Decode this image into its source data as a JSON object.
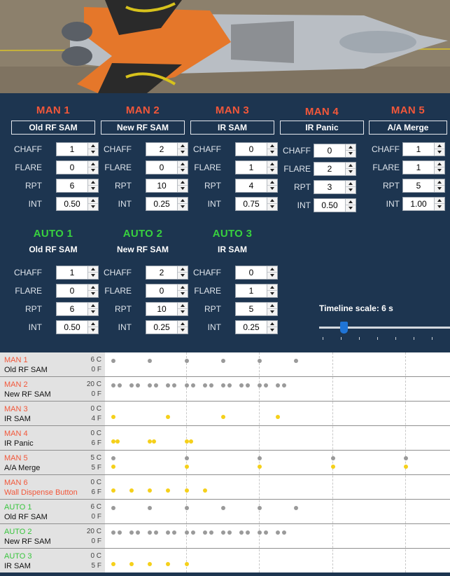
{
  "colors": {
    "man": "#f2573a",
    "auto": "#38d13f",
    "panel": "#1d3550",
    "chaff_dot": "#9a9a9a",
    "flare_dot": "#f5d01a",
    "slider": "#1f74d6"
  },
  "field_labels": {
    "chaff": "CHAFF",
    "flare": "FLARE",
    "rpt": "RPT",
    "int": "INT"
  },
  "manual_programs": [
    {
      "title": "MAN 1",
      "name": "Old RF SAM",
      "chaff": "1",
      "flare": "0",
      "rpt": "6",
      "int": "0.50"
    },
    {
      "title": "MAN 2",
      "name": "New RF SAM",
      "chaff": "2",
      "flare": "0",
      "rpt": "10",
      "int": "0.25"
    },
    {
      "title": "MAN 3",
      "name": "IR SAM",
      "chaff": "0",
      "flare": "1",
      "rpt": "4",
      "int": "0.75"
    },
    {
      "title": "MAN 4",
      "name": "IR Panic",
      "chaff": "0",
      "flare": "2",
      "rpt": "3",
      "int": "0.50"
    },
    {
      "title": "MAN 5",
      "name": "A/A Merge",
      "chaff": "1",
      "flare": "1",
      "rpt": "5",
      "int": "1.00"
    }
  ],
  "auto_programs": [
    {
      "title": "AUTO 1",
      "name": "Old RF SAM",
      "chaff": "1",
      "flare": "0",
      "rpt": "6",
      "int": "0.50"
    },
    {
      "title": "AUTO 2",
      "name": "New RF SAM",
      "chaff": "2",
      "flare": "0",
      "rpt": "10",
      "int": "0.25"
    },
    {
      "title": "AUTO 3",
      "name": "IR SAM",
      "chaff": "0",
      "flare": "1",
      "rpt": "5",
      "int": "0.25"
    }
  ],
  "timeline_scale": {
    "label": "Timeline scale: 6 s",
    "seconds": 6
  },
  "timeline": [
    {
      "name": "MAN 1",
      "kind": "man",
      "desc": "Old RF SAM",
      "c": "6 C",
      "f": "0 F",
      "chaff_per": 1,
      "flare_per": 0,
      "rpt": 6,
      "int": 0.5
    },
    {
      "name": "MAN 2",
      "kind": "man",
      "desc": "New RF SAM",
      "c": "20 C",
      "f": "0 F",
      "chaff_per": 2,
      "flare_per": 0,
      "rpt": 10,
      "int": 0.25
    },
    {
      "name": "MAN 3",
      "kind": "man",
      "desc": "IR SAM",
      "c": "0 C",
      "f": "4 F",
      "chaff_per": 0,
      "flare_per": 1,
      "rpt": 4,
      "int": 0.75
    },
    {
      "name": "MAN 4",
      "kind": "man",
      "desc": "IR Panic",
      "c": "0 C",
      "f": "6 F",
      "chaff_per": 0,
      "flare_per": 2,
      "rpt": 3,
      "int": 0.5
    },
    {
      "name": "MAN 5",
      "kind": "man",
      "desc": "A/A Merge",
      "c": "5 C",
      "f": "5 F",
      "chaff_per": 1,
      "flare_per": 1,
      "rpt": 5,
      "int": 1.0
    },
    {
      "name": "MAN 6",
      "kind": "man",
      "desc": "Wall Dispense Button",
      "desc_highlight": true,
      "c": "0 C",
      "f": "6 F",
      "chaff_per": 0,
      "flare_per": 1,
      "rpt": 6,
      "int": 0.25
    },
    {
      "name": "AUTO 1",
      "kind": "auto",
      "desc": "Old RF SAM",
      "c": "6 C",
      "f": "0 F",
      "chaff_per": 1,
      "flare_per": 0,
      "rpt": 6,
      "int": 0.5
    },
    {
      "name": "AUTO 2",
      "kind": "auto",
      "desc": "New RF SAM",
      "c": "20 C",
      "f": "0 F",
      "chaff_per": 2,
      "flare_per": 0,
      "rpt": 10,
      "int": 0.25
    },
    {
      "name": "AUTO 3",
      "kind": "auto",
      "desc": "IR SAM",
      "c": "0 C",
      "f": "5 F",
      "chaff_per": 0,
      "flare_per": 1,
      "rpt": 5,
      "int": 0.25
    }
  ]
}
